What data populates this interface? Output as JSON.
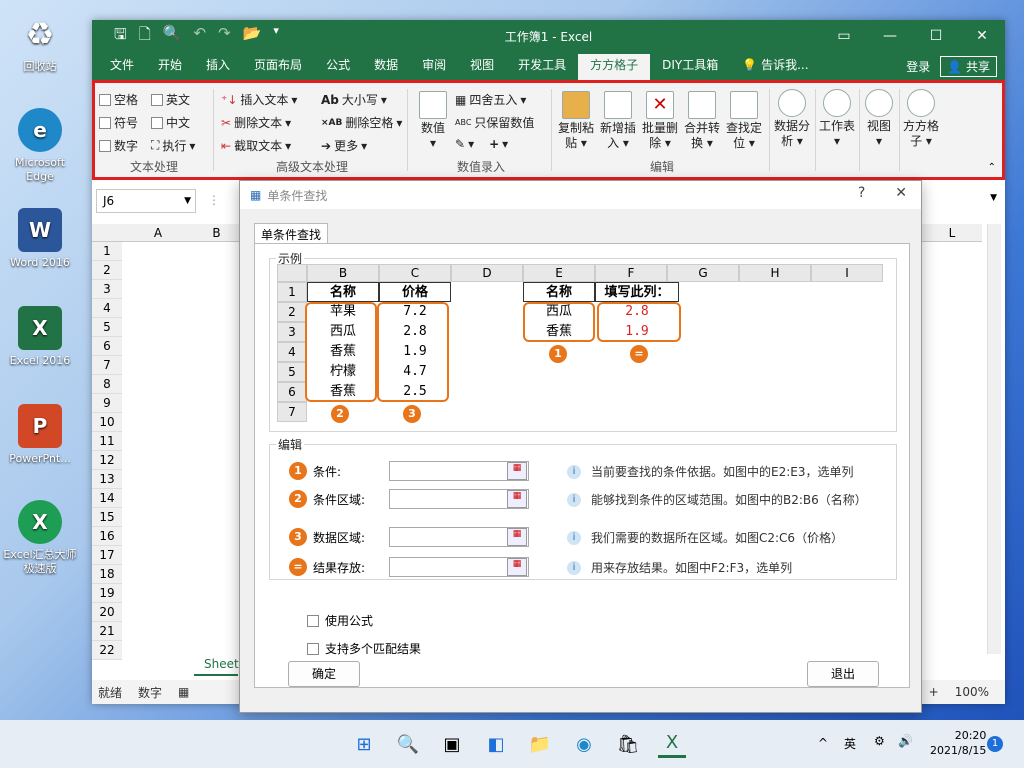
{
  "desktop": {
    "icons": [
      {
        "label": "回收站",
        "icon": "recycle-bin-icon",
        "color": "#5a8fd8"
      },
      {
        "label": "Microsoft Edge",
        "icon": "edge-icon",
        "color": "#1e88c8"
      },
      {
        "label": "Word 2016",
        "icon": "word-icon",
        "color": "#2b579a"
      },
      {
        "label": "Excel 2016",
        "icon": "excel-icon",
        "color": "#217346"
      },
      {
        "label": "PowerPnt...",
        "icon": "powerpoint-icon",
        "color": "#d24726"
      },
      {
        "label": "Excel汇总大师 极速版",
        "icon": "excel-master-icon",
        "color": "#1e9e55"
      }
    ]
  },
  "excel": {
    "title": "工作簿1 - Excel",
    "menu": [
      "文件",
      "开始",
      "插入",
      "页面布局",
      "公式",
      "数据",
      "审阅",
      "视图",
      "开发工具",
      "方方格子",
      "DIY工具箱"
    ],
    "active_menu": "方方格子",
    "tell_me": "告诉我...",
    "login": "登录",
    "share": "共享",
    "ribbon": {
      "text_group": {
        "items": [
          "空格",
          "英文",
          "符号",
          "中文",
          "数字",
          "执行"
        ],
        "label": "文本处理"
      },
      "adv_group": {
        "items": [
          "插入文本",
          "删除文本",
          "截取文本",
          "大小写",
          "删除空格",
          "更多"
        ],
        "label": "高级文本处理"
      },
      "num_group": {
        "big": "数值",
        "items": [
          "四舍五入",
          "只保留数值"
        ],
        "label": "数值录入"
      },
      "edit_group": {
        "buttons": [
          "复制粘贴",
          "新增插入",
          "批量删除",
          "合并转换",
          "查找定位"
        ],
        "label": "编辑"
      },
      "extra": [
        "数据分析",
        "工作表",
        "视图",
        "方方格子"
      ]
    },
    "name_box": "J6",
    "columns": [
      "A",
      "B",
      "L"
    ],
    "rows": [
      "1",
      "2",
      "3",
      "4",
      "5",
      "6",
      "7",
      "8",
      "9",
      "10",
      "11",
      "12",
      "13",
      "14",
      "15",
      "16",
      "17",
      "18",
      "19",
      "20",
      "21",
      "22"
    ],
    "sheet_tab": "Sheet",
    "status": {
      "ready": "就绪",
      "mode": "数字",
      "zoom": "100%"
    }
  },
  "dialog": {
    "title": "单条件查找",
    "tab": "单条件查找",
    "example_legend": "示例",
    "edit_legend": "编辑",
    "example": {
      "col_headers": [
        "B",
        "C",
        "D",
        "E",
        "F",
        "G",
        "H",
        "I"
      ],
      "row_nums": [
        "1",
        "2",
        "3",
        "4",
        "5",
        "6",
        "7"
      ],
      "names": [
        "名称",
        "苹果",
        "西瓜",
        "香蕉",
        "柠檬",
        "香蕉"
      ],
      "prices": [
        "价格",
        "7.2",
        "2.8",
        "1.9",
        "4.7",
        "2.5"
      ],
      "lookup_names": [
        "名称",
        "西瓜",
        "香蕉"
      ],
      "lookup_head": "填写此列：",
      "lookup_values": [
        "2.8",
        "1.9"
      ],
      "badges": [
        "1",
        "2",
        "3",
        "="
      ]
    },
    "fields": [
      {
        "badge": "1",
        "label": "条件:",
        "hint": "当前要查找的条件依据。如图中的E2:E3，选单列"
      },
      {
        "badge": "2",
        "label": "条件区域:",
        "hint": "能够找到条件的区域范围。如图中的B2:B6（名称）"
      },
      {
        "badge": "3",
        "label": "数据区域:",
        "hint": "我们需要的数据所在区域。如图C2:C6（价格）"
      },
      {
        "badge": "=",
        "label": "结果存放:",
        "hint": "用来存放结果。如图中F2:F3，选单列"
      }
    ],
    "use_formula": "使用公式",
    "multi_match": "支持多个匹配结果",
    "ok": "确定",
    "exit": "退出"
  },
  "taskbar": {
    "lang": "英",
    "time": "20:20",
    "date": "2021/8/15",
    "notif": "1"
  }
}
